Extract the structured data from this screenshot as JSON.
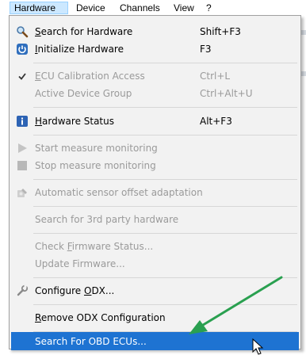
{
  "menubar": {
    "items": [
      {
        "label": "Hardware",
        "active": true
      },
      {
        "label": "Device"
      },
      {
        "label": "Channels"
      },
      {
        "label": "View"
      },
      {
        "label": "?"
      }
    ]
  },
  "menu": {
    "items": [
      {
        "id": "search-hw",
        "pre": "",
        "u": "S",
        "post": "earch for Hardware",
        "shortcut": "Shift+F3",
        "icon": "magnifier-icon",
        "enabled": true
      },
      {
        "id": "init-hw",
        "pre": "",
        "u": "I",
        "post": "nitialize Hardware",
        "shortcut": "F3",
        "icon": "power-icon",
        "enabled": true
      },
      {
        "id": "ecu-cal",
        "pre": "",
        "u": "E",
        "post": "CU Calibration Access",
        "shortcut": "Ctrl+L",
        "icon": "checkmark-icon",
        "enabled": false
      },
      {
        "id": "active-group",
        "label": "Active Device Group",
        "shortcut": "Ctrl+Alt+U",
        "enabled": false
      },
      {
        "id": "hw-status",
        "pre": "",
        "u": "H",
        "post": "ardware Status",
        "shortcut": "Alt+F3",
        "icon": "info-icon",
        "enabled": true
      },
      {
        "id": "start-mon",
        "label": "Start measure monitoring",
        "icon": "play-icon",
        "enabled": false
      },
      {
        "id": "stop-mon",
        "label": "Stop measure monitoring",
        "icon": "stop-icon",
        "enabled": false
      },
      {
        "id": "auto-offset",
        "label": "Automatic sensor offset adaptation",
        "icon": "sensor-icon",
        "enabled": false
      },
      {
        "id": "search-3rd",
        "label": "Search for 3rd party hardware",
        "enabled": false
      },
      {
        "id": "check-fw",
        "pre": "Check ",
        "u": "F",
        "post": "irmware Status...",
        "enabled": false
      },
      {
        "id": "update-fw",
        "label": "Update Firmware...",
        "enabled": false
      },
      {
        "id": "config-odx",
        "pre": "Configure ",
        "u": "O",
        "post": "DX...",
        "icon": "wrench-icon",
        "enabled": true
      },
      {
        "id": "remove-odx",
        "pre": "",
        "u": "R",
        "post": "emove ODX Configuration",
        "enabled": true
      },
      {
        "id": "search-obd",
        "label": "Search For OBD ECUs...",
        "enabled": true,
        "highlighted": true
      }
    ]
  },
  "colors": {
    "highlight": "#1e73d2",
    "arrow": "#2aa050",
    "disabled_text": "#9a9a9a"
  }
}
